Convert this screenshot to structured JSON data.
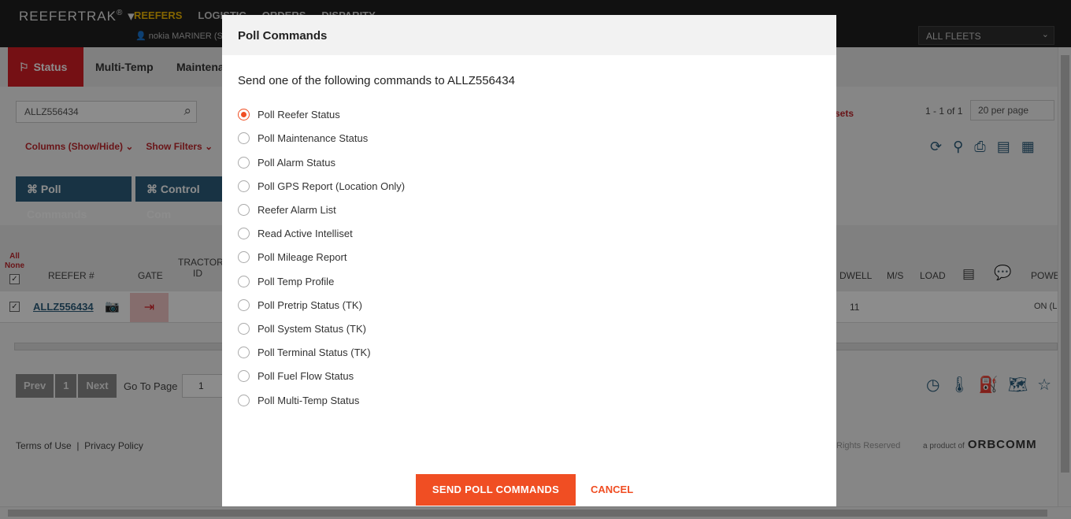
{
  "app": {
    "brand": "REEFERTRAK",
    "nav": [
      "REEFERS",
      "LOGISTIC",
      "ORDERS",
      "DISPARITY"
    ],
    "user": "nokia MARINER (ST",
    "fleet_select": "ALL FLEETS"
  },
  "tabs": [
    "Status",
    "Multi-Temp",
    "Maintena"
  ],
  "toolbar": {
    "search_value": "ALLZ556434",
    "columns_label": "Columns (Show/Hide)",
    "filters_label": "Show Filters",
    "poll_button": "Poll Commands",
    "control_button": "Control Com",
    "resets_label": "sets",
    "page_info": "1 - 1 of 1",
    "per_page": "20 per page"
  },
  "grid": {
    "all_none": [
      "All",
      "None"
    ],
    "headers": [
      "REEFER #",
      "GATE",
      "TRACTOR ID",
      "DWELL",
      "M/S",
      "LOAD",
      "POWE"
    ],
    "row": {
      "reefer": "ALLZ556434",
      "dwell": "11",
      "power": "ON (L"
    }
  },
  "pager": {
    "prev": "Prev",
    "page": "1",
    "next": "Next",
    "goto_label": "Go To Page",
    "goto_value": "1"
  },
  "footer": {
    "terms": "Terms of Use",
    "privacy": "Privacy Policy",
    "rights": "Rights Reserved",
    "product_of": "a product of",
    "company": "ORBCOMM"
  },
  "modal": {
    "title": "Poll Commands",
    "intro": "Send one of the following commands to ALLZ556434",
    "options": [
      "Poll Reefer Status",
      "Poll Maintenance Status",
      "Poll Alarm Status",
      "Poll GPS Report (Location Only)",
      "Reefer Alarm List",
      "Read Active Intelliset",
      "Poll Mileage Report",
      "Poll Temp Profile",
      "Poll Pretrip Status (TK)",
      "Poll System Status (TK)",
      "Poll Terminal Status (TK)",
      "Poll Fuel Flow Status",
      "Poll Multi-Temp Status"
    ],
    "selected_index": 0,
    "send_button": "SEND POLL COMMANDS",
    "cancel_button": "CANCEL",
    "accent_color": "#f04e23"
  }
}
